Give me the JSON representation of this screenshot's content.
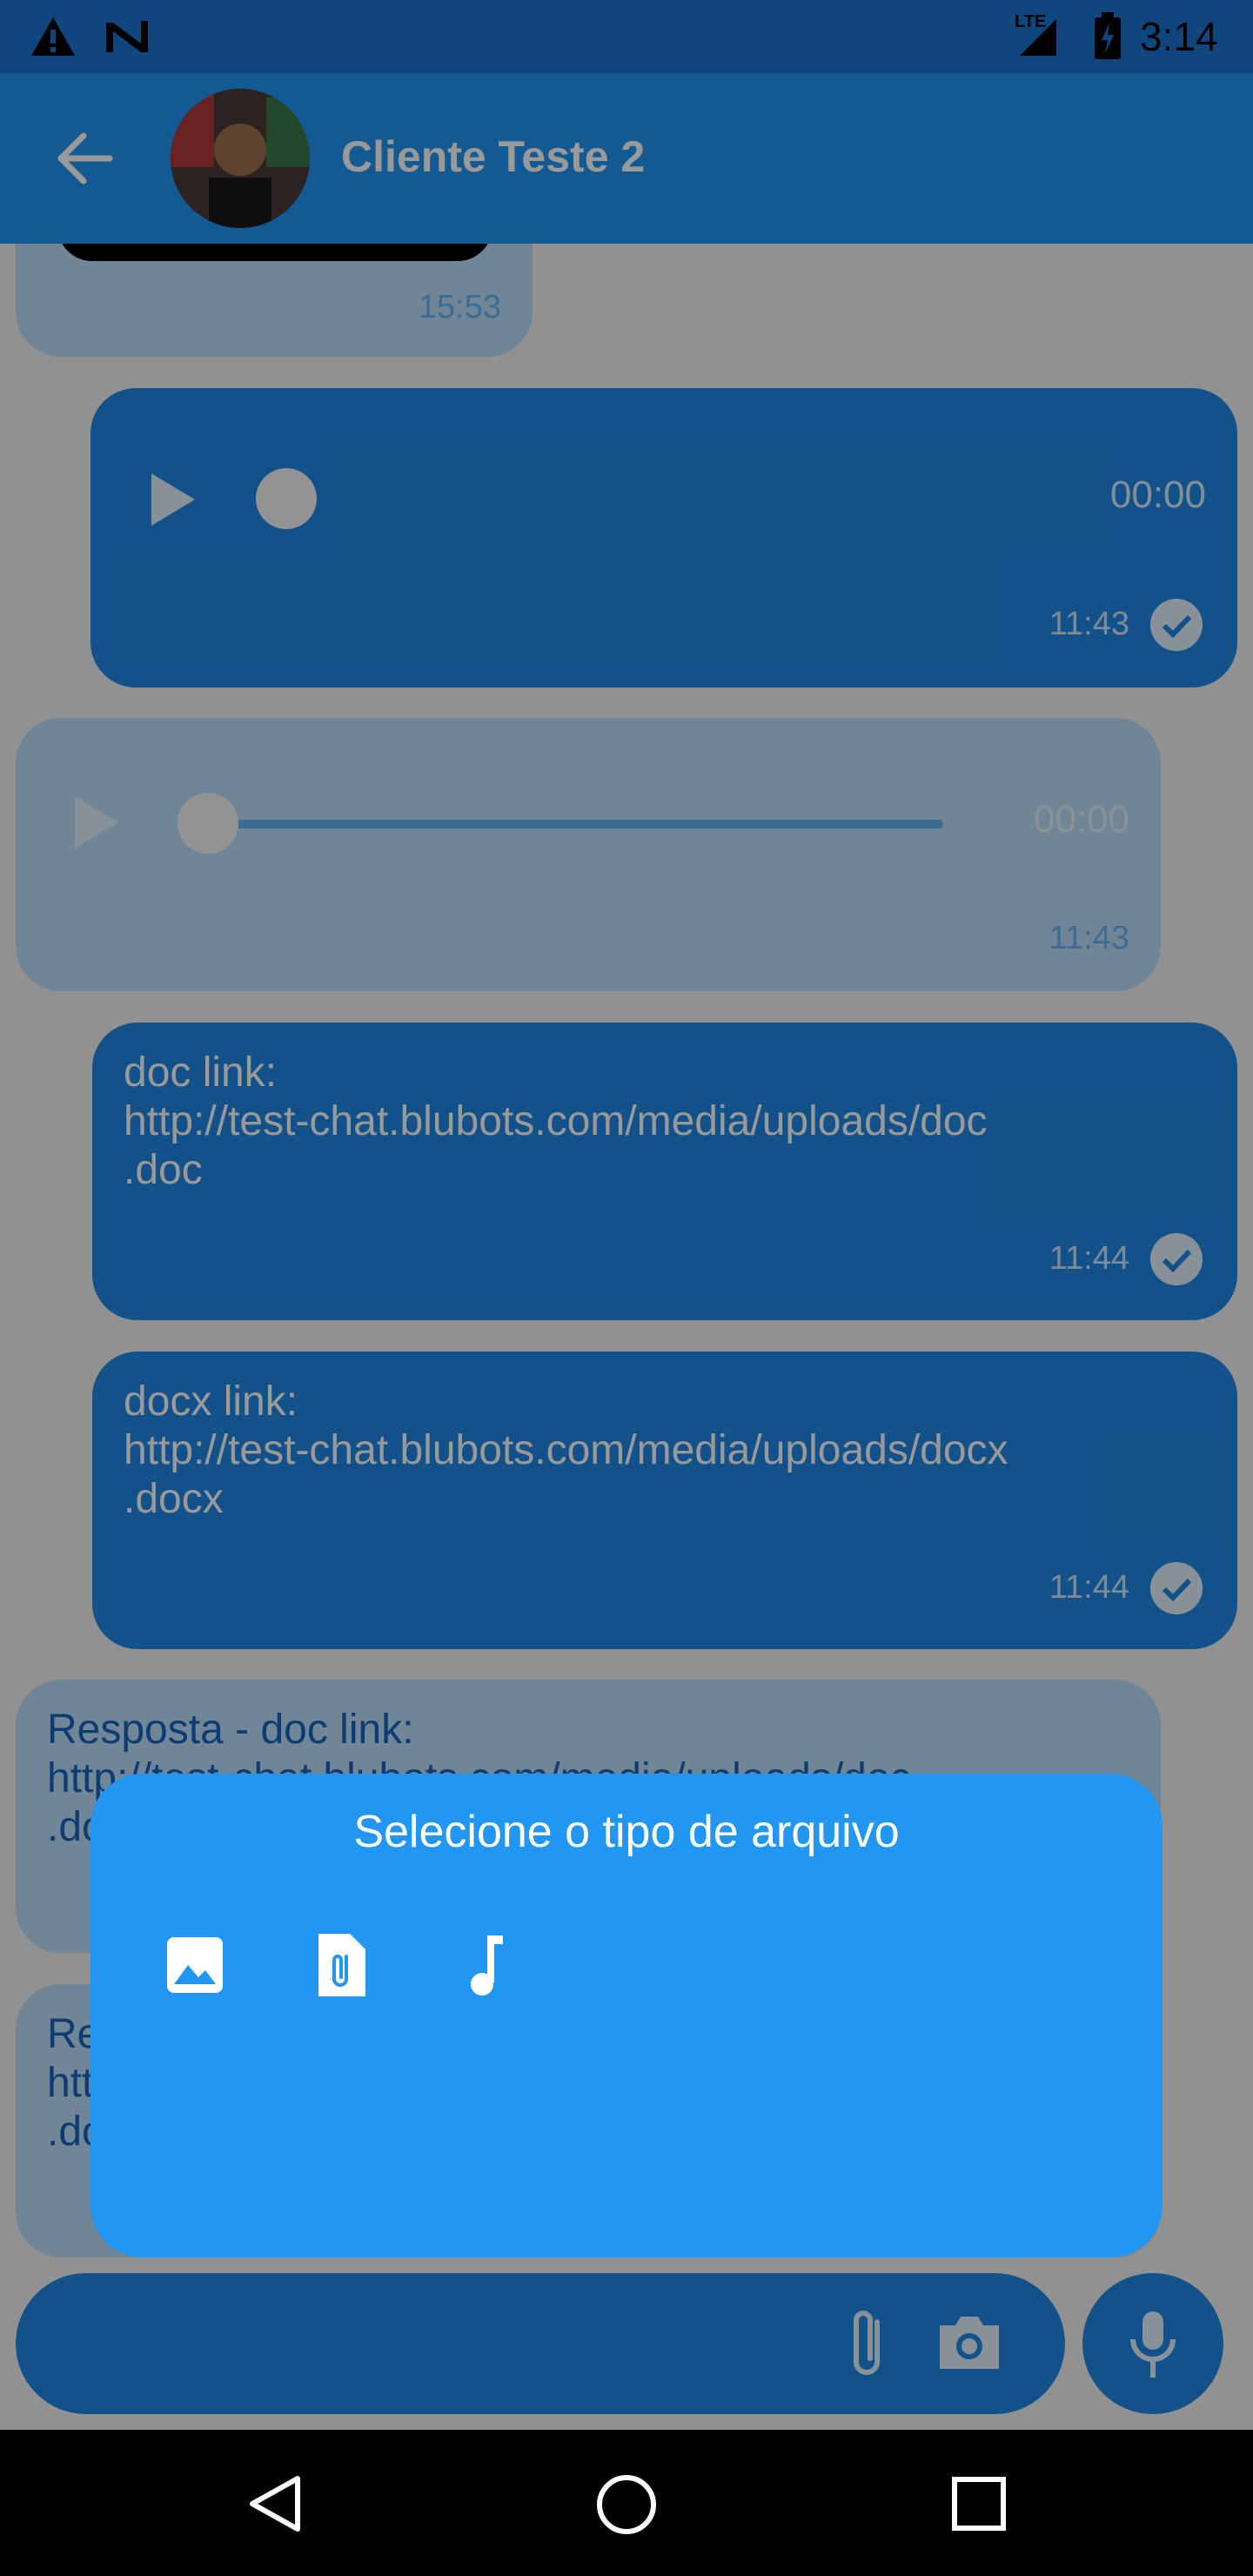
{
  "status_bar": {
    "time": "3:14",
    "network": "LTE"
  },
  "app_bar": {
    "title": "Cliente Teste 2"
  },
  "messages": [
    {
      "type": "image",
      "direction": "in",
      "time": "15:53"
    },
    {
      "type": "audio",
      "direction": "out",
      "duration": "00:00",
      "time": "11:43",
      "read": true
    },
    {
      "type": "audio",
      "direction": "in",
      "duration": "00:00",
      "time": "11:43"
    },
    {
      "type": "text",
      "direction": "out",
      "text": "doc link:\nhttp://test-chat.blubots.com/media/uploads/doc\n.doc",
      "time": "11:44",
      "read": true
    },
    {
      "type": "text",
      "direction": "out",
      "text": "docx link:\nhttp://test-chat.blubots.com/media/uploads/docx\n.docx",
      "time": "11:44",
      "read": true
    },
    {
      "type": "text",
      "direction": "in",
      "text": "Resposta - doc link:\nhttp://test-chat.blubots.com/media/uploads/doc\n.doc"
    },
    {
      "type": "text",
      "direction": "in",
      "text": "Re\nhtt\n.do"
    }
  ],
  "input_bar": {
    "attach_icon": "paperclip-icon",
    "camera_icon": "camera-icon",
    "mic_icon": "microphone-icon"
  },
  "file_picker": {
    "title": "Selecione o tipo de arquivo",
    "options": [
      {
        "icon": "image-icon",
        "kind": "image"
      },
      {
        "icon": "document-attachment-icon",
        "kind": "document"
      },
      {
        "icon": "music-note-icon",
        "kind": "audio"
      }
    ]
  },
  "colors": {
    "primary": "#2196f3",
    "primary_dark": "#1976d2",
    "bubble_out": "#1f88e5",
    "bubble_in": "#bbdefb"
  }
}
